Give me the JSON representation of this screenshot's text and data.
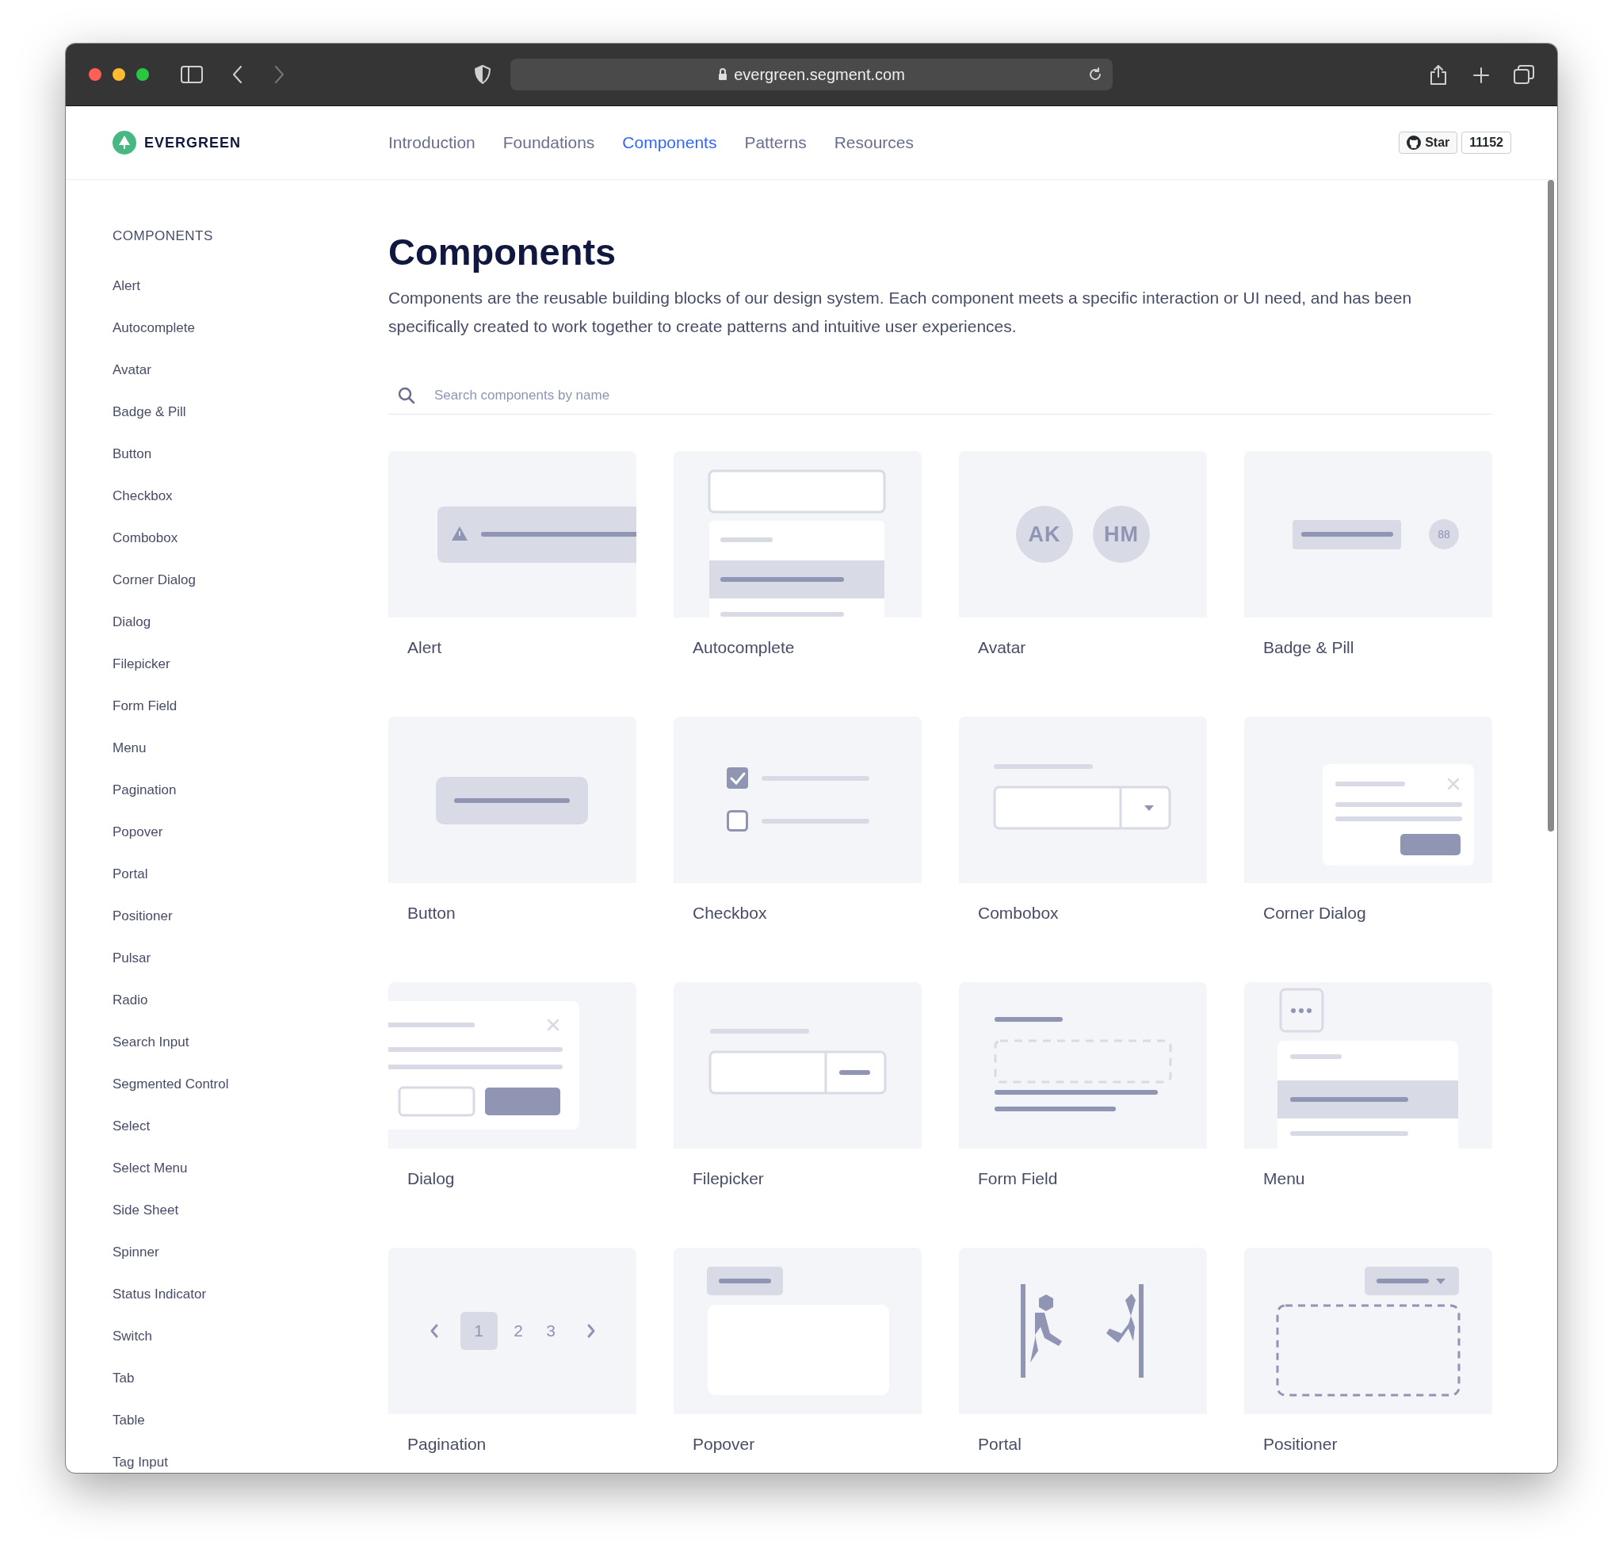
{
  "browser": {
    "url": "evergreen.segment.com"
  },
  "header": {
    "logo": "EVERGREEN",
    "nav": [
      {
        "label": "Introduction",
        "selected": false
      },
      {
        "label": "Foundations",
        "selected": false
      },
      {
        "label": "Components",
        "selected": true
      },
      {
        "label": "Patterns",
        "selected": false
      },
      {
        "label": "Resources",
        "selected": false
      }
    ],
    "github": {
      "star": "Star",
      "count": "11152"
    }
  },
  "sidebar": {
    "heading": "COMPONENTS",
    "items": [
      "Alert",
      "Autocomplete",
      "Avatar",
      "Badge & Pill",
      "Button",
      "Checkbox",
      "Combobox",
      "Corner Dialog",
      "Dialog",
      "Filepicker",
      "Form Field",
      "Menu",
      "Pagination",
      "Popover",
      "Portal",
      "Positioner",
      "Pulsar",
      "Radio",
      "Search Input",
      "Segmented Control",
      "Select",
      "Select Menu",
      "Side Sheet",
      "Spinner",
      "Status Indicator",
      "Switch",
      "Tab",
      "Table",
      "Tag Input"
    ]
  },
  "page": {
    "title": "Components",
    "description": "Components are the reusable building blocks of our design system. Each component meets a specific interaction or UI need, and has been specifically created to work together to create patterns and intuitive user experiences.",
    "search": {
      "placeholder": "Search components by name"
    }
  },
  "cards": [
    {
      "label": "Alert",
      "kind": "alert"
    },
    {
      "label": "Autocomplete",
      "kind": "autocomplete"
    },
    {
      "label": "Avatar",
      "kind": "avatar",
      "initials": [
        "AK",
        "HM"
      ]
    },
    {
      "label": "Badge & Pill",
      "kind": "badge",
      "count": "88"
    },
    {
      "label": "Button",
      "kind": "button"
    },
    {
      "label": "Checkbox",
      "kind": "checkbox",
      "checkboxes": [
        {
          "checked": true
        },
        {
          "checked": false
        }
      ]
    },
    {
      "label": "Combobox",
      "kind": "combobox"
    },
    {
      "label": "Corner Dialog",
      "kind": "corner-dialog"
    },
    {
      "label": "Dialog",
      "kind": "dialog"
    },
    {
      "label": "Filepicker",
      "kind": "filepicker"
    },
    {
      "label": "Form Field",
      "kind": "form-field"
    },
    {
      "label": "Menu",
      "kind": "menu"
    },
    {
      "label": "Pagination",
      "kind": "pagination",
      "pages": [
        {
          "label": "1",
          "selected": true
        },
        {
          "label": "2",
          "selected": false
        },
        {
          "label": "3",
          "selected": false
        }
      ]
    },
    {
      "label": "Popover",
      "kind": "popover"
    },
    {
      "label": "Portal",
      "kind": "portal"
    },
    {
      "label": "Positioner",
      "kind": "positioner"
    }
  ]
}
